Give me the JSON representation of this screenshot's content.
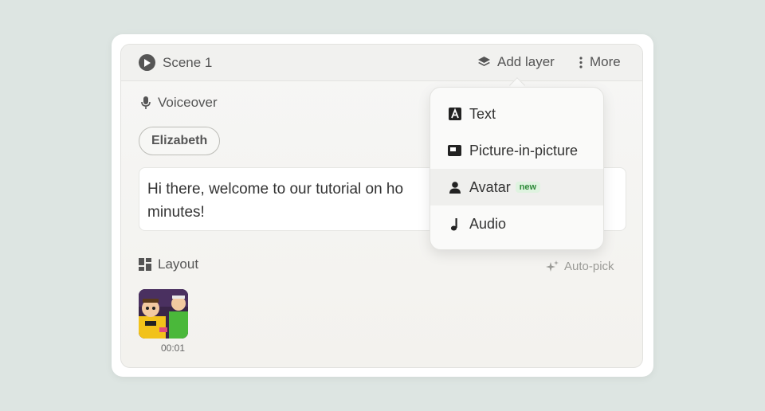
{
  "scene": {
    "title": "Scene 1",
    "add_layer_label": "Add layer",
    "more_label": "More"
  },
  "voiceover": {
    "label": "Voiceover",
    "voice": "Elizabeth",
    "script": "Hi there, welcome to our tutorial on ho",
    "script_line2": "minutes!"
  },
  "layout": {
    "label": "Layout",
    "autopick_label": "Auto-pick",
    "thumbnail_time": "00:01"
  },
  "add_layer_menu": {
    "items": [
      {
        "label": "Text",
        "icon": "text-a-icon"
      },
      {
        "label": "Picture-in-picture",
        "icon": "pip-icon"
      },
      {
        "label": "Avatar",
        "icon": "person-icon",
        "badge": "new"
      },
      {
        "label": "Audio",
        "icon": "music-note-icon"
      }
    ]
  },
  "colors": {
    "background": "#dde5e2",
    "card": "#ffffff",
    "badge_green": "#2f8a3a"
  }
}
